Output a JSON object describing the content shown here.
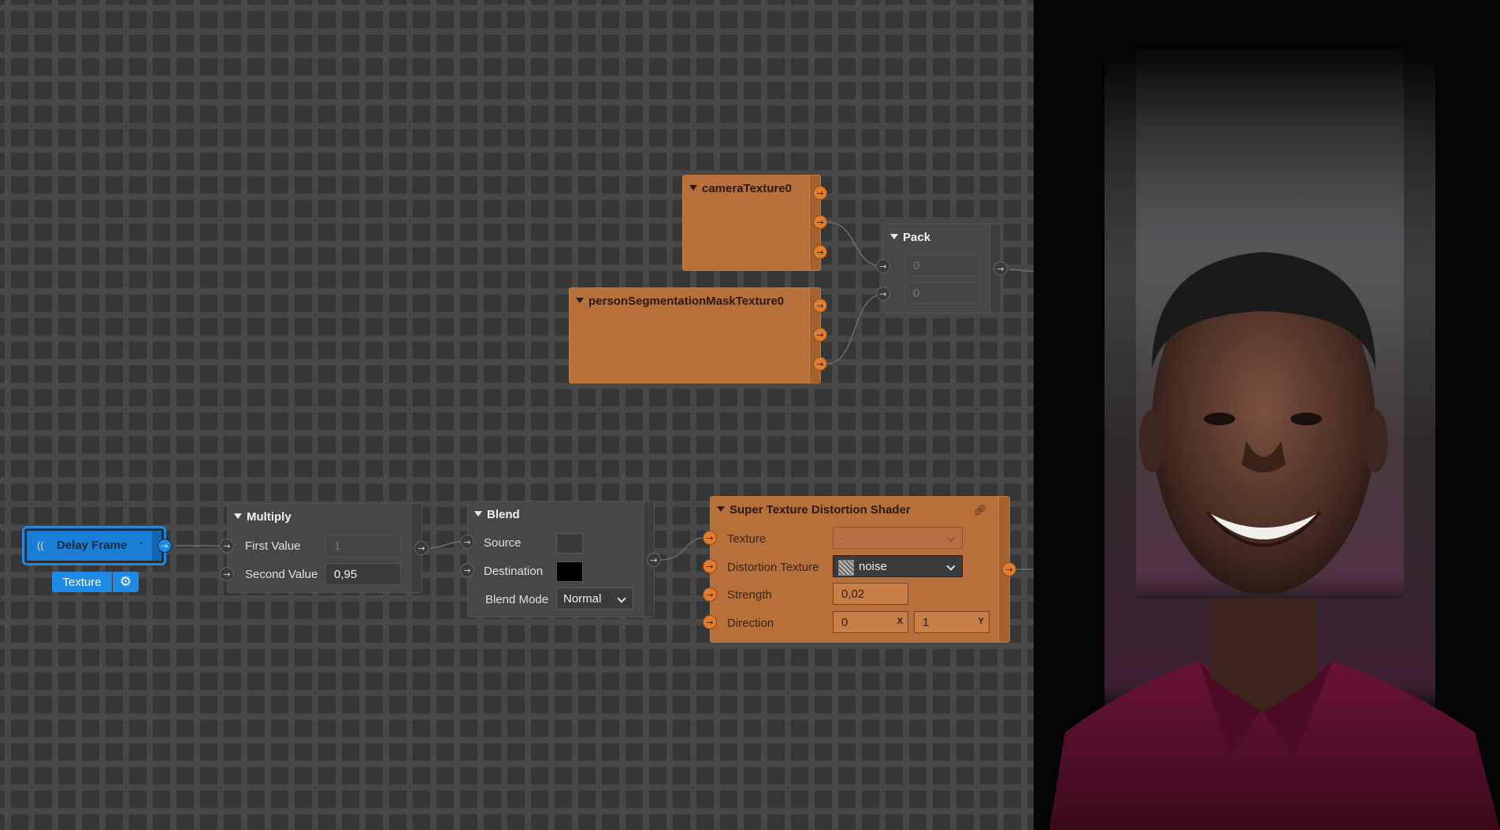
{
  "nodes": {
    "camera": {
      "title": "cameraTexture0"
    },
    "person": {
      "title": "personSegmentationMaskTexture0"
    },
    "pack": {
      "title": "Pack",
      "value1": "0",
      "value2": "0"
    },
    "delay": {
      "title": "Delay Frame",
      "pill_label": "Texture"
    },
    "multiply": {
      "title": "Multiply",
      "first_label": "First Value",
      "first_value": "1",
      "second_label": "Second Value",
      "second_value": "0,95"
    },
    "blend": {
      "title": "Blend",
      "source_label": "Source",
      "destination_label": "Destination",
      "mode_label": "Blend Mode",
      "mode_value": "Normal"
    },
    "shader": {
      "title": "Super Texture Distortion Shader",
      "texture_label": "Texture",
      "texture_value": "-",
      "distortion_label": "Distortion Texture",
      "distortion_value": "noise",
      "strength_label": "Strength",
      "strength_value": "0,02",
      "direction_label": "Direction",
      "direction_x": "0",
      "direction_y": "1",
      "axis_x": "X",
      "axis_y": "Y"
    }
  },
  "colors": {
    "canvas": "#363636",
    "node_gray": "#474747",
    "node_orange": "#b8703a",
    "port_orange": "#e07d2e",
    "accent_blue": "#1f8ae6"
  },
  "icons": [
    "arrow-right-icon",
    "gear-icon",
    "link-icon",
    "chevron-down-icon",
    "signal-icon",
    "noise-thumbnail"
  ]
}
